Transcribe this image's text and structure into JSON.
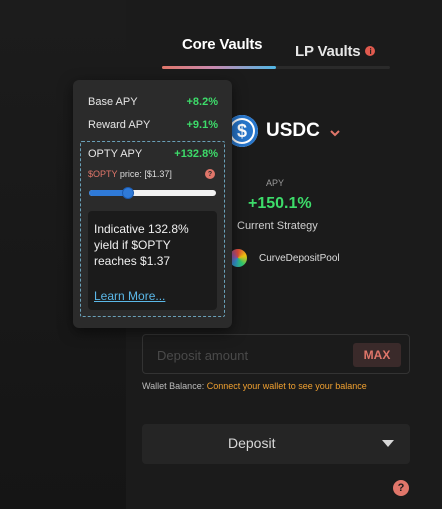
{
  "tabs": {
    "core": "Core Vaults",
    "lp": "LP Vaults",
    "lp_info_icon": "info-icon"
  },
  "token": {
    "name": "USDC",
    "icon_glyph": "$",
    "icon": "usdc-coin-icon",
    "chevron": "chevron-down-icon"
  },
  "apy": {
    "label": "APY",
    "value": "+150.1%",
    "subtitle": "Current Strategy"
  },
  "strategy": {
    "name": "CurveDepositPool",
    "icon": "curve-logo-icon"
  },
  "tooltip": {
    "base_label": "Base APY",
    "base_value": "+8.2%",
    "reward_label": "Reward APY",
    "reward_value": "+9.1%",
    "opty_label": "OPTY APY",
    "opty_value": "+132.8%",
    "price_symbol": "$OPTY",
    "price_text": " price: [$1.37]",
    "help_glyph": "?",
    "slider_fraction": 0.29,
    "indicative_text": "Indicative 132.8% yield if $OPTY reaches $1.37",
    "learn_more": "Learn More..."
  },
  "deposit": {
    "placeholder": "Deposit amount",
    "max_label": "MAX",
    "wallet_prefix": "Wallet Balance: ",
    "wallet_link": "Connect your wallet to see your balance",
    "button_label": "Deposit"
  },
  "help_button": "?",
  "colors": {
    "background": "#1b1b1b",
    "positive": "#3ddc6a",
    "accent": "#e0766a",
    "link": "#5bb8e8",
    "warning_link": "#f0a030",
    "usdc_blue": "#2775ca"
  }
}
